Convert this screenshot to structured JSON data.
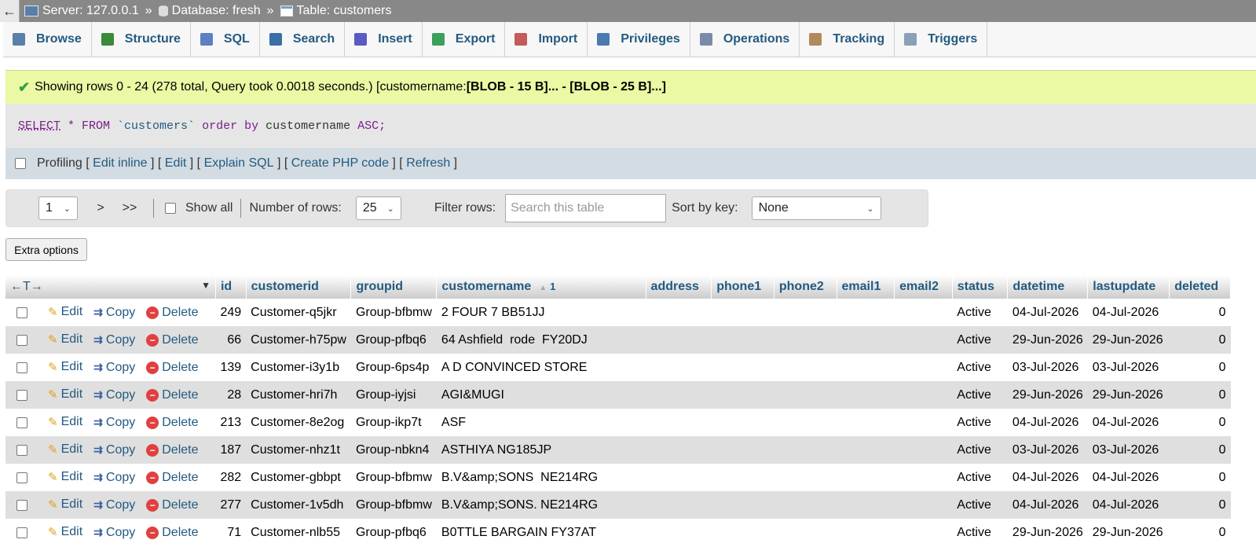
{
  "breadcrumb": {
    "back_label": "←",
    "server": "Server: 127.0.0.1",
    "database": "Database: fresh",
    "table": "Table: customers",
    "sep": "»"
  },
  "tabs": [
    {
      "label": "Browse",
      "icon": "browse-icon"
    },
    {
      "label": "Structure",
      "icon": "structure-icon"
    },
    {
      "label": "SQL",
      "icon": "sql-icon"
    },
    {
      "label": "Search",
      "icon": "search-icon"
    },
    {
      "label": "Insert",
      "icon": "insert-icon"
    },
    {
      "label": "Export",
      "icon": "export-icon"
    },
    {
      "label": "Import",
      "icon": "import-icon"
    },
    {
      "label": "Privileges",
      "icon": "privileges-icon"
    },
    {
      "label": "Operations",
      "icon": "operations-icon"
    },
    {
      "label": "Tracking",
      "icon": "tracking-icon"
    },
    {
      "label": "Triggers",
      "icon": "triggers-icon"
    }
  ],
  "message": {
    "text": "Showing rows 0 - 24 (278 total, Query took 0.0018 seconds.) [customername: ",
    "bold": "[BLOB - 15 B]... - [BLOB - 25 B]...]",
    "color": "#ebf8a4"
  },
  "sql": {
    "select": "SELECT",
    "star": " * ",
    "from": "FROM ",
    "table": "`customers`",
    "orderby": " order by ",
    "column": "customername ",
    "asc": "ASC;"
  },
  "profiling": {
    "label": "Profiling",
    "links": [
      "Edit inline",
      "Edit",
      "Explain SQL",
      "Create PHP code",
      "Refresh"
    ]
  },
  "nav": {
    "page": "1",
    "next": ">",
    "last": ">>",
    "show_all": "Show all",
    "rows_label": "Number of rows:",
    "rows_value": "25",
    "filter_label": "Filter rows:",
    "filter_placeholder": "Search this table",
    "sort_label": "Sort by key:",
    "sort_value": "None"
  },
  "extra_options": "Extra options",
  "table": {
    "arrows": "←T→",
    "columns": [
      "id",
      "customerid",
      "groupid",
      "customername",
      "address",
      "phone1",
      "phone2",
      "email1",
      "email2",
      "status",
      "datetime",
      "lastupdate",
      "deleted"
    ],
    "sort_marker": "1",
    "actions": {
      "edit": "Edit",
      "copy": "Copy",
      "delete": "Delete"
    },
    "rows": [
      {
        "id": "249",
        "customerid": "Customer-q5jkr",
        "groupid": "Group-bfbmw",
        "customername": "2 FOUR 7 BB51JJ",
        "status": "Active",
        "datetime": "04-Jul-2026",
        "lastupdate": "04-Jul-2026",
        "deleted": "0"
      },
      {
        "id": "66",
        "customerid": "Customer-h75pw",
        "groupid": "Group-pfbq6",
        "customername": "64 Ashfield  rode  FY20DJ",
        "status": "Active",
        "datetime": "29-Jun-2026",
        "lastupdate": "29-Jun-2026",
        "deleted": "0"
      },
      {
        "id": "139",
        "customerid": "Customer-i3y1b",
        "groupid": "Group-6ps4p",
        "customername": "A D CONVINCED STORE",
        "status": "Active",
        "datetime": "03-Jul-2026",
        "lastupdate": "03-Jul-2026",
        "deleted": "0"
      },
      {
        "id": "28",
        "customerid": "Customer-hri7h",
        "groupid": "Group-iyjsi",
        "customername": "AGI&MUGI",
        "status": "Active",
        "datetime": "29-Jun-2026",
        "lastupdate": "29-Jun-2026",
        "deleted": "0"
      },
      {
        "id": "213",
        "customerid": "Customer-8e2og",
        "groupid": "Group-ikp7t",
        "customername": "ASF",
        "status": "Active",
        "datetime": "04-Jul-2026",
        "lastupdate": "04-Jul-2026",
        "deleted": "0"
      },
      {
        "id": "187",
        "customerid": "Customer-nhz1t",
        "groupid": "Group-nbkn4",
        "customername": "ASTHIYA NG185JP",
        "status": "Active",
        "datetime": "03-Jul-2026",
        "lastupdate": "03-Jul-2026",
        "deleted": "0"
      },
      {
        "id": "282",
        "customerid": "Customer-gbbpt",
        "groupid": "Group-bfbmw",
        "customername": "B.V&amp;SONS  NE214RG",
        "status": "Active",
        "datetime": "04-Jul-2026",
        "lastupdate": "04-Jul-2026",
        "deleted": "0"
      },
      {
        "id": "277",
        "customerid": "Customer-1v5dh",
        "groupid": "Group-bfbmw",
        "customername": "B.V&amp;SONS. NE214RG",
        "status": "Active",
        "datetime": "04-Jul-2026",
        "lastupdate": "04-Jul-2026",
        "deleted": "0"
      },
      {
        "id": "71",
        "customerid": "Customer-nlb55",
        "groupid": "Group-pfbq6",
        "customername": "B0TTLE BARGAIN FY37AT",
        "status": "Active",
        "datetime": "29-Jun-2026",
        "lastupdate": "29-Jun-2026",
        "deleted": "0"
      }
    ]
  }
}
